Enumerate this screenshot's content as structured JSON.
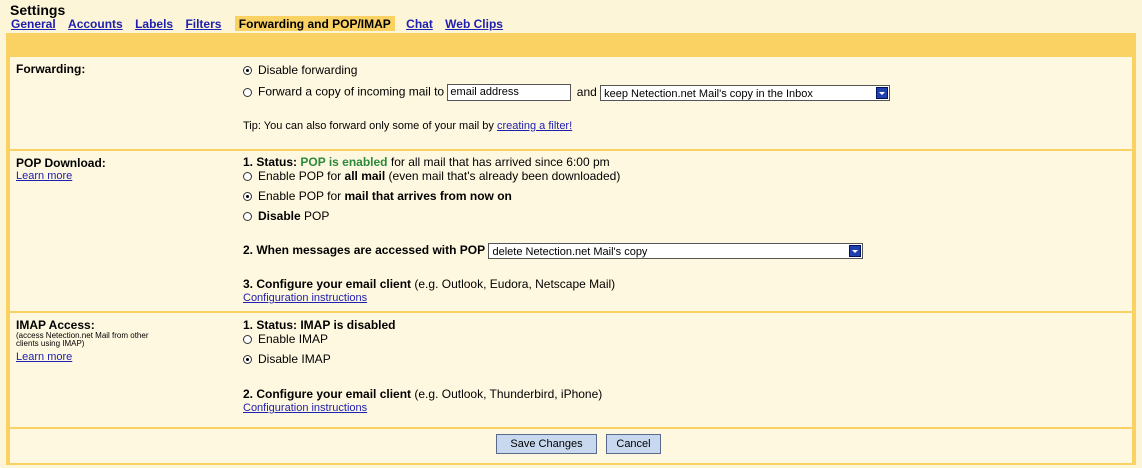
{
  "header": {
    "title": "Settings",
    "tabs": [
      {
        "label": "General"
      },
      {
        "label": "Accounts"
      },
      {
        "label": "Labels"
      },
      {
        "label": "Filters"
      },
      {
        "label": "Forwarding and POP/IMAP",
        "active": true
      },
      {
        "label": "Chat"
      },
      {
        "label": "Web Clips"
      }
    ]
  },
  "forwarding": {
    "label": "Forwarding:",
    "disable_label": "Disable forwarding",
    "disable_checked": true,
    "forward_label": "Forward a copy of incoming mail to",
    "forward_checked": false,
    "email_value": "email address",
    "and_label": "and",
    "copy_option": "keep Netection.net Mail's copy in the Inbox",
    "tip_text": "Tip: You can also forward only some of your mail by",
    "tip_link": "creating a filter!"
  },
  "pop": {
    "label": "POP Download:",
    "learn_more": "Learn more",
    "status_prefix": "1. Status:",
    "status_value": "POP is enabled",
    "status_suffix": "for all mail that has arrived since 6:00 pm",
    "opt1_prefix": "Enable POP for",
    "opt1_bold": "all mail",
    "opt1_suffix": "(even mail that's already been downloaded)",
    "opt1_checked": false,
    "opt2_prefix": "Enable POP for",
    "opt2_bold": "mail that arrives from now on",
    "opt2_checked": true,
    "opt3_bold": "Disable",
    "opt3_suffix": "POP",
    "opt3_checked": false,
    "access_label": "2. When messages are accessed with POP",
    "access_option": "delete Netection.net Mail's copy",
    "configure_bold": "3. Configure your email client",
    "configure_suffix": "(e.g. Outlook, Eudora, Netscape Mail)",
    "config_link": "Configuration instructions"
  },
  "imap": {
    "label": "IMAP Access:",
    "sublabel_line1": "(access Netection.net Mail from other",
    "sublabel_line2": "clients using IMAP)",
    "learn_more": "Learn more",
    "status": "1. Status: IMAP is disabled",
    "enable_label": "Enable IMAP",
    "enable_checked": false,
    "disable_label": "Disable IMAP",
    "disable_checked": true,
    "configure_bold": "2. Configure your email client",
    "configure_suffix": "(e.g. Outlook, Thunderbird, iPhone)",
    "config_link": "Configuration instructions"
  },
  "footer": {
    "save_label": "Save Changes",
    "cancel_label": "Cancel"
  },
  "colors": {
    "page_bg": "#fcf5d7",
    "section_bg": "#fff8e0",
    "accent": "#fad163",
    "link": "#2020b0",
    "status_green": "#2a8a3a",
    "button_bg": "#c8d8ee"
  }
}
